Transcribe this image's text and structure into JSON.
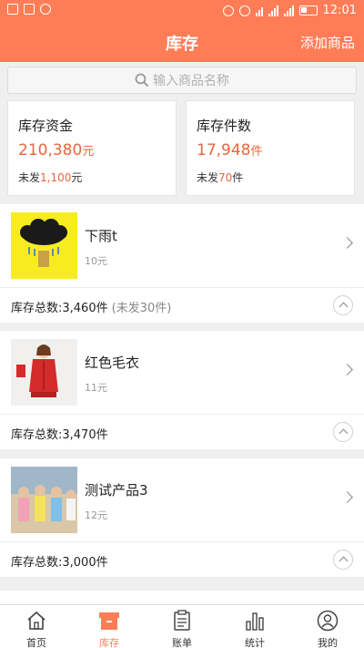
{
  "status_bar": {
    "time": "12:01"
  },
  "header": {
    "title": "库存",
    "add_button": "添加商品"
  },
  "search": {
    "placeholder": "输入商品名称"
  },
  "stats": [
    {
      "title": "库存资金",
      "value": "210,380",
      "unit": "元",
      "sub_prefix": "未发",
      "sub_value": "1,100",
      "sub_unit": "元"
    },
    {
      "title": "库存件数",
      "value": "17,948",
      "unit": "件",
      "sub_prefix": "未发",
      "sub_value": "70",
      "sub_unit": "件"
    }
  ],
  "products": [
    {
      "name": "下雨t",
      "price": "10元",
      "total": "库存总数:3,460件",
      "pending": "(未发30件)"
    },
    {
      "name": "红色毛衣",
      "price": "11元",
      "total": "库存总数:3,470件",
      "pending": ""
    },
    {
      "name": "测试产品3",
      "price": "12元",
      "total": "库存总数:3,000件",
      "pending": ""
    }
  ],
  "tabs": [
    {
      "label": "首页",
      "icon": "home-icon",
      "active": false
    },
    {
      "label": "库存",
      "icon": "inventory-box-icon",
      "active": true
    },
    {
      "label": "账单",
      "icon": "bill-clipboard-icon",
      "active": false
    },
    {
      "label": "统计",
      "icon": "bar-chart-icon",
      "active": false
    },
    {
      "label": "我的",
      "icon": "user-icon",
      "active": false
    }
  ],
  "colors": {
    "accent": "#ff7d56",
    "value": "#e8663d"
  }
}
